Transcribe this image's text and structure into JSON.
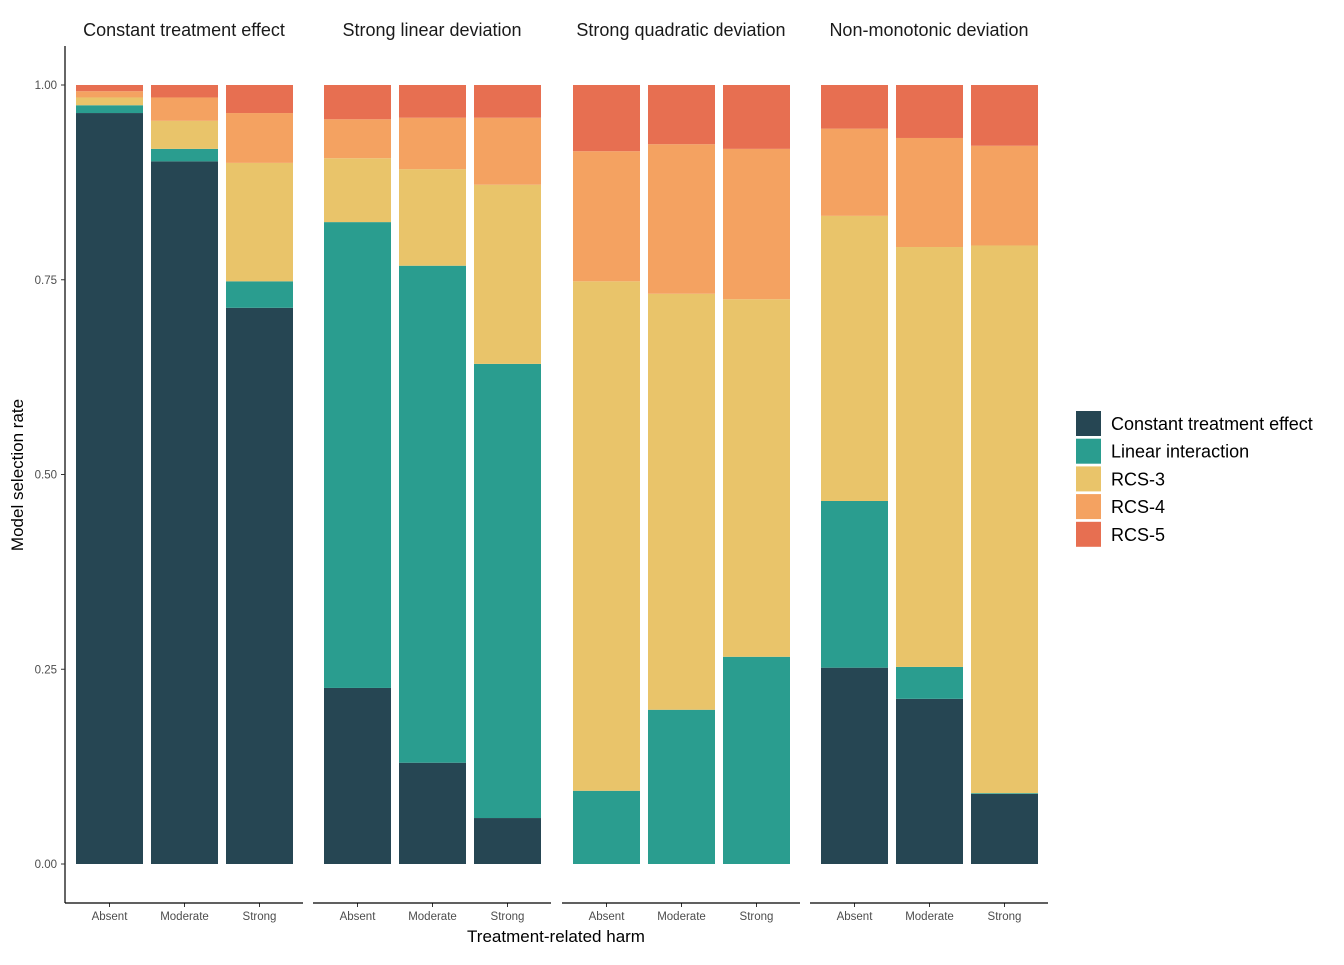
{
  "chart_data": {
    "type": "bar",
    "stacked": true,
    "ylabel": "Model selection rate",
    "xlabel": "Treatment-related harm",
    "ylim": [
      0,
      1
    ],
    "yticks": [
      "0.00",
      "0.25",
      "0.50",
      "0.75",
      "1.00"
    ],
    "ytick_values": [
      0,
      0.25,
      0.5,
      0.75,
      1.0
    ],
    "categories": [
      "Absent",
      "Moderate",
      "Strong"
    ],
    "legend_position": "right",
    "legend": [
      {
        "name": "Constant treatment effect",
        "color": "#264653"
      },
      {
        "name": "Linear interaction",
        "color": "#2a9d8f"
      },
      {
        "name": "RCS-3",
        "color": "#e9c46a"
      },
      {
        "name": "RCS-4",
        "color": "#f4a261"
      },
      {
        "name": "RCS-5",
        "color": "#e76f51"
      }
    ],
    "panels": [
      {
        "title": "Constant treatment effect",
        "series": [
          {
            "name": "Constant treatment effect",
            "values": [
              0.964,
              0.902,
              0.714
            ]
          },
          {
            "name": "Linear interaction",
            "values": [
              0.01,
              0.016,
              0.034
            ]
          },
          {
            "name": "RCS-3",
            "values": [
              0.01,
              0.036,
              0.152
            ]
          },
          {
            "name": "RCS-4",
            "values": [
              0.008,
              0.03,
              0.064
            ]
          },
          {
            "name": "RCS-5",
            "values": [
              0.008,
              0.016,
              0.036
            ]
          }
        ]
      },
      {
        "title": "Strong linear deviation",
        "series": [
          {
            "name": "Constant treatment effect",
            "values": [
              0.226,
              0.13,
              0.059
            ]
          },
          {
            "name": "Linear interaction",
            "values": [
              0.598,
              0.638,
              0.583
            ]
          },
          {
            "name": "RCS-3",
            "values": [
              0.082,
              0.124,
              0.23
            ]
          },
          {
            "name": "RCS-4",
            "values": [
              0.05,
              0.066,
              0.086
            ]
          },
          {
            "name": "RCS-5",
            "values": [
              0.044,
              0.042,
              0.042
            ]
          }
        ]
      },
      {
        "title": "Strong quadratic deviation",
        "series": [
          {
            "name": "Constant treatment effect",
            "values": [
              0.0,
              0.0,
              0.0
            ]
          },
          {
            "name": "Linear interaction",
            "values": [
              0.094,
              0.198,
              0.266
            ]
          },
          {
            "name": "RCS-3",
            "values": [
              0.654,
              0.534,
              0.459
            ]
          },
          {
            "name": "RCS-4",
            "values": [
              0.167,
              0.192,
              0.193
            ]
          },
          {
            "name": "RCS-5",
            "values": [
              0.085,
              0.076,
              0.082
            ]
          }
        ]
      },
      {
        "title": "Non-monotonic deviation",
        "series": [
          {
            "name": "Constant treatment effect",
            "values": [
              0.252,
              0.212,
              0.09
            ]
          },
          {
            "name": "Linear interaction",
            "values": [
              0.214,
              0.041,
              0.001
            ]
          },
          {
            "name": "RCS-3",
            "values": [
              0.366,
              0.539,
              0.703
            ]
          },
          {
            "name": "RCS-4",
            "values": [
              0.112,
              0.14,
              0.128
            ]
          },
          {
            "name": "RCS-5",
            "values": [
              0.056,
              0.068,
              0.078
            ]
          }
        ]
      }
    ]
  }
}
